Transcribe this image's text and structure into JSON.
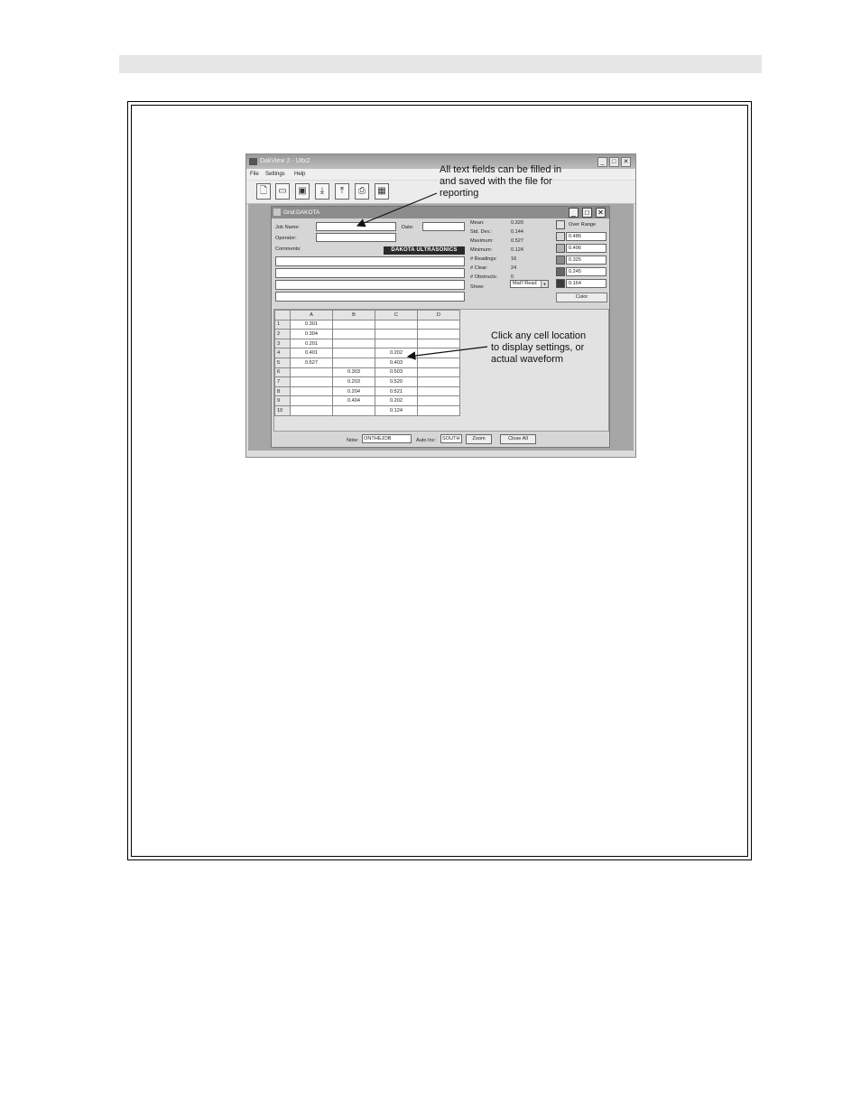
{
  "app": {
    "title": "DakView 2 - Ultx2",
    "menu": [
      "File",
      "Settings",
      "Help"
    ],
    "toolbar_icons": [
      "new-file-icon",
      "open-folder-icon",
      "save-icon",
      "download-icon",
      "upload-icon",
      "print-icon",
      "grid-icon"
    ]
  },
  "grid_window": {
    "title": "Grid:DAKOTA",
    "job_name_label": "Job Name:",
    "job_name_value": "",
    "date_label": "Date:",
    "date_value": "",
    "operator_label": "Operator:",
    "operator_value": "",
    "comments_label": "Comments:",
    "logo_text": "DAKOTA ULTRASONICS",
    "stats": [
      {
        "label": "Mean:",
        "value": "0.320"
      },
      {
        "label": "Std. Dev.:",
        "value": "0.144"
      },
      {
        "label": "Maximum:",
        "value": "0.527"
      },
      {
        "label": "Minimum:",
        "value": "0.124"
      },
      {
        "label": "# Readings:",
        "value": "16"
      },
      {
        "label": "# Clear:",
        "value": "24"
      },
      {
        "label": "# Obstructs:",
        "value": "0"
      }
    ],
    "show_label": "Show:",
    "show_value": "Mat'l Read",
    "over_range_label": "Over Range",
    "ranges": [
      "0.486",
      "0.406",
      "0.325",
      "0.245",
      "0.164"
    ],
    "range_colors": [
      "#d8d8d8",
      "#b4b4b4",
      "#8a8a8a",
      "#666666",
      "#3a3a3a"
    ],
    "color_button": "Color",
    "columns": [
      "A",
      "B",
      "C",
      "D"
    ],
    "rows": [
      {
        "n": "1",
        "cells": [
          "0.301",
          "",
          "",
          ""
        ]
      },
      {
        "n": "2",
        "cells": [
          "0.304",
          "",
          "",
          ""
        ]
      },
      {
        "n": "3",
        "cells": [
          "0.201",
          "",
          "",
          ""
        ]
      },
      {
        "n": "4",
        "cells": [
          "0.401",
          "",
          "0.202",
          ""
        ]
      },
      {
        "n": "5",
        "cells": [
          "0.527",
          "",
          "0.403",
          ""
        ]
      },
      {
        "n": "6",
        "cells": [
          "",
          "0.303",
          "0.503",
          ""
        ]
      },
      {
        "n": "7",
        "cells": [
          "",
          "0.203",
          "0.520",
          ""
        ]
      },
      {
        "n": "8",
        "cells": [
          "",
          "0.204",
          "0.521",
          ""
        ]
      },
      {
        "n": "9",
        "cells": [
          "",
          "0.404",
          "0.202",
          ""
        ]
      },
      {
        "n": "10",
        "cells": [
          "",
          "",
          "0.124",
          ""
        ]
      }
    ],
    "note_label": "Note:",
    "note_value": "ONTHEJOB",
    "auto_inc_label": "Auto Inc:",
    "auto_inc_value": "SOUTH",
    "zoom_button": "Zoom",
    "close_all_button": "Close All"
  },
  "callouts": {
    "top": [
      "All text fields can be filled in",
      "and saved with the file for",
      "reporting"
    ],
    "right": [
      "Click any cell location",
      "to display settings, or",
      "actual waveform"
    ]
  }
}
